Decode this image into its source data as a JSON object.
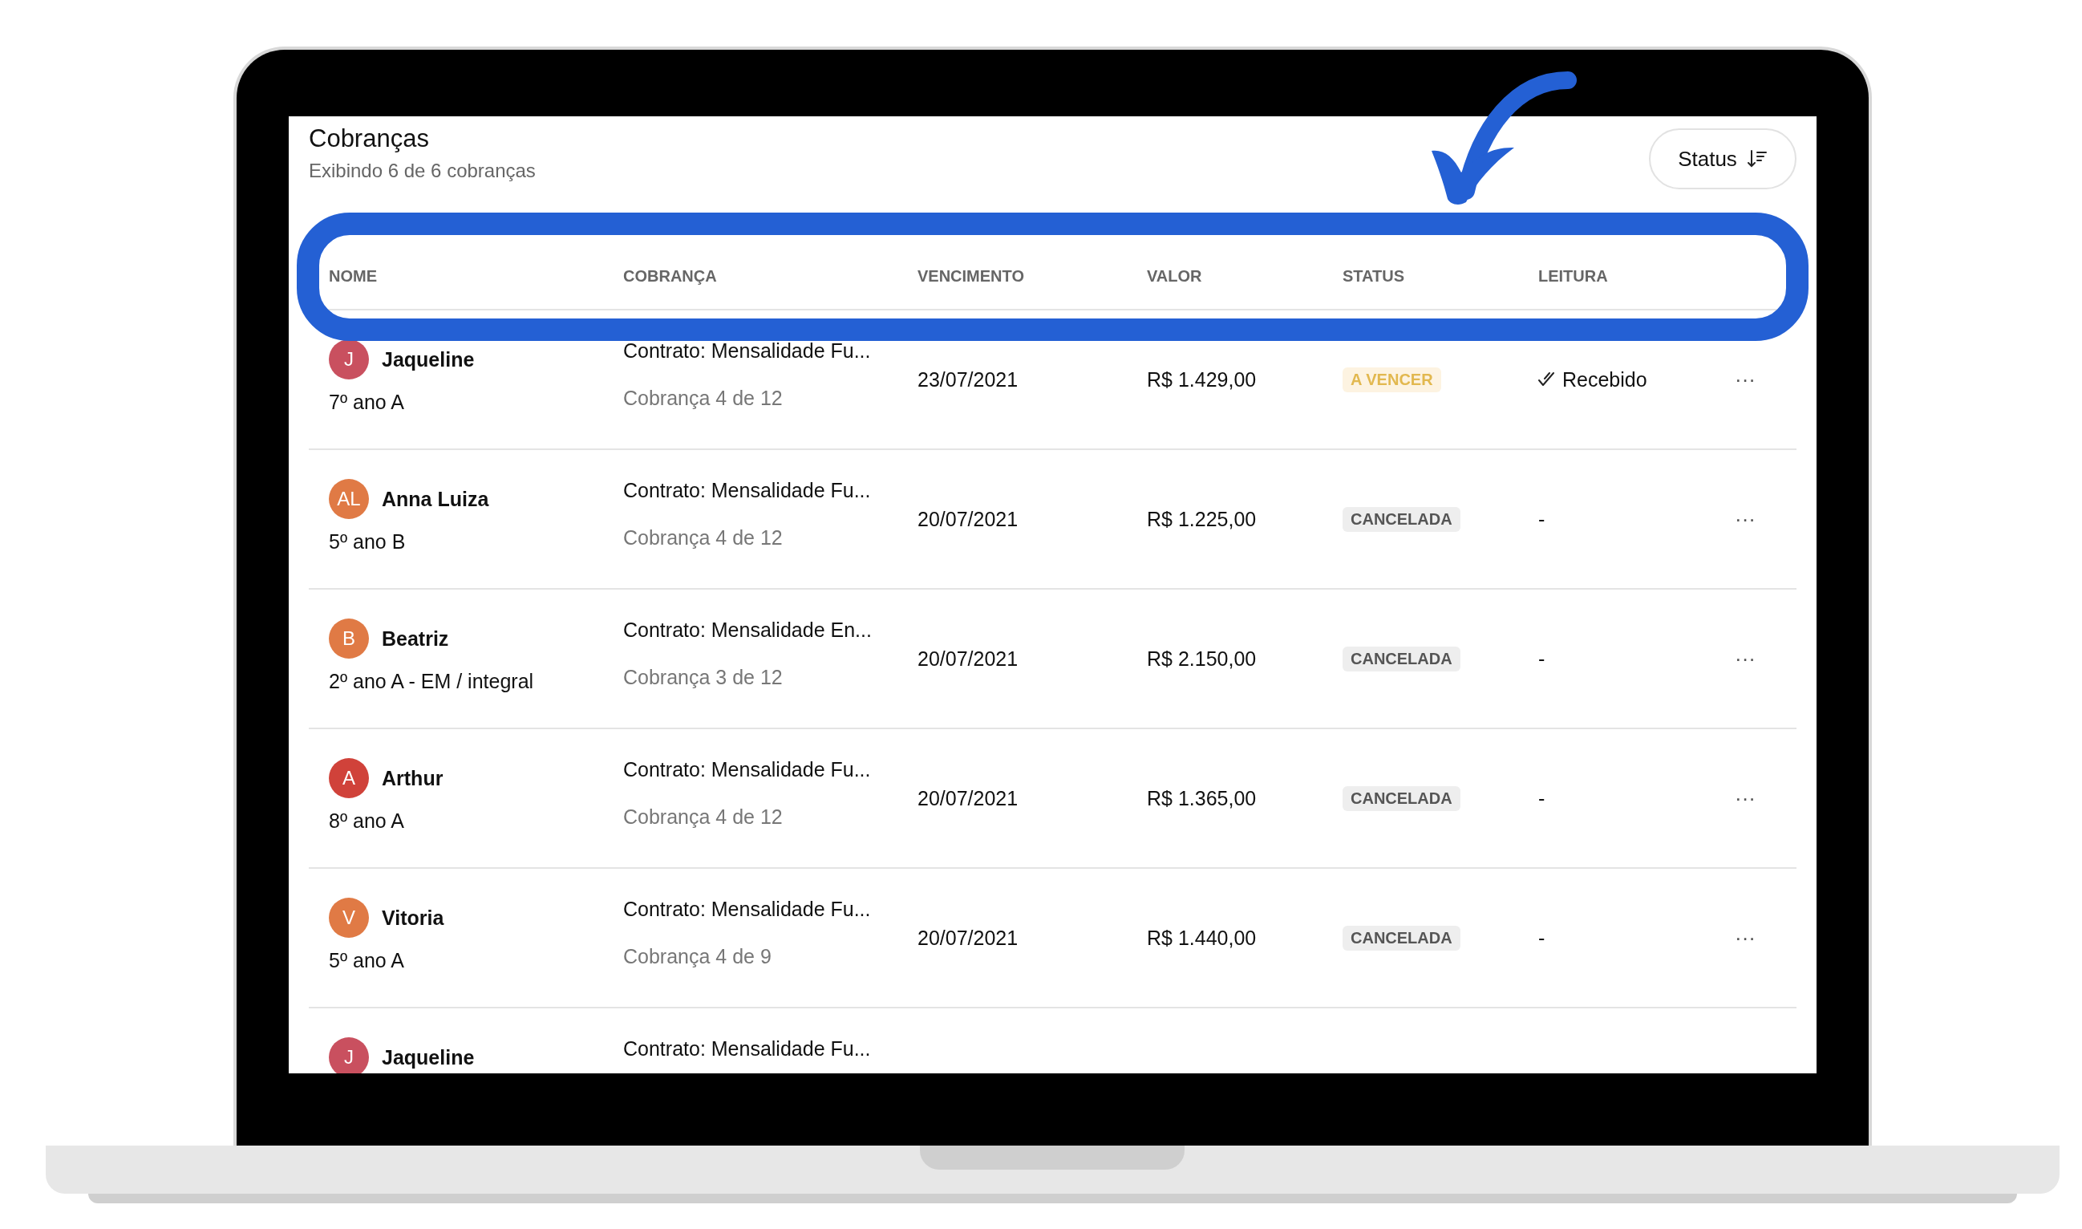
{
  "page": {
    "title": "Cobranças",
    "subtitle": "Exibindo 6 de 6 cobranças",
    "sort_button": "Status"
  },
  "table": {
    "columns": [
      "NOME",
      "COBRANÇA",
      "VENCIMENTO",
      "VALOR",
      "STATUS",
      "LEITURA"
    ],
    "rows": [
      {
        "initials": "J",
        "color": "#c9505f",
        "name": "Jaqueline",
        "class": "7º ano A",
        "contract": "Contrato: Mensalidade Fu...",
        "installment": "Cobrança 4 de 12",
        "due": "23/07/2021",
        "value": "R$ 1.429,00",
        "status": {
          "text": "A VENCER",
          "kind": "pending"
        },
        "reading": {
          "text": "Recebido",
          "received": true
        },
        "menu": "···"
      },
      {
        "initials": "AL",
        "color": "#e07a45",
        "name": "Anna Luiza",
        "class": "5º ano B",
        "contract": "Contrato: Mensalidade Fu...",
        "installment": "Cobrança 4 de 12",
        "due": "20/07/2021",
        "value": "R$ 1.225,00",
        "status": {
          "text": "CANCELADA",
          "kind": "cancelled"
        },
        "reading": {
          "text": "-",
          "received": false
        },
        "menu": "···"
      },
      {
        "initials": "B",
        "color": "#e07a45",
        "name": "Beatriz",
        "class": "2º ano A - EM / integral",
        "contract": "Contrato: Mensalidade En...",
        "installment": "Cobrança 3 de 12",
        "due": "20/07/2021",
        "value": "R$ 2.150,00",
        "status": {
          "text": "CANCELADA",
          "kind": "cancelled"
        },
        "reading": {
          "text": "-",
          "received": false
        },
        "menu": "···"
      },
      {
        "initials": "A",
        "color": "#d0423a",
        "name": "Arthur",
        "class": "8º ano A",
        "contract": "Contrato: Mensalidade Fu...",
        "installment": "Cobrança 4 de 12",
        "due": "20/07/2021",
        "value": "R$ 1.365,00",
        "status": {
          "text": "CANCELADA",
          "kind": "cancelled"
        },
        "reading": {
          "text": "-",
          "received": false
        },
        "menu": "···"
      },
      {
        "initials": "V",
        "color": "#e07a45",
        "name": "Vitoria",
        "class": "5º ano A",
        "contract": "Contrato: Mensalidade Fu...",
        "installment": "Cobrança 4 de 9",
        "due": "20/07/2021",
        "value": "R$ 1.440,00",
        "status": {
          "text": "CANCELADA",
          "kind": "cancelled"
        },
        "reading": {
          "text": "-",
          "received": false
        },
        "menu": "···"
      },
      {
        "initials": "J",
        "color": "#c9505f",
        "name": "Jaqueline",
        "contract": "Contrato: Mensalidade Fu..."
      }
    ]
  }
}
